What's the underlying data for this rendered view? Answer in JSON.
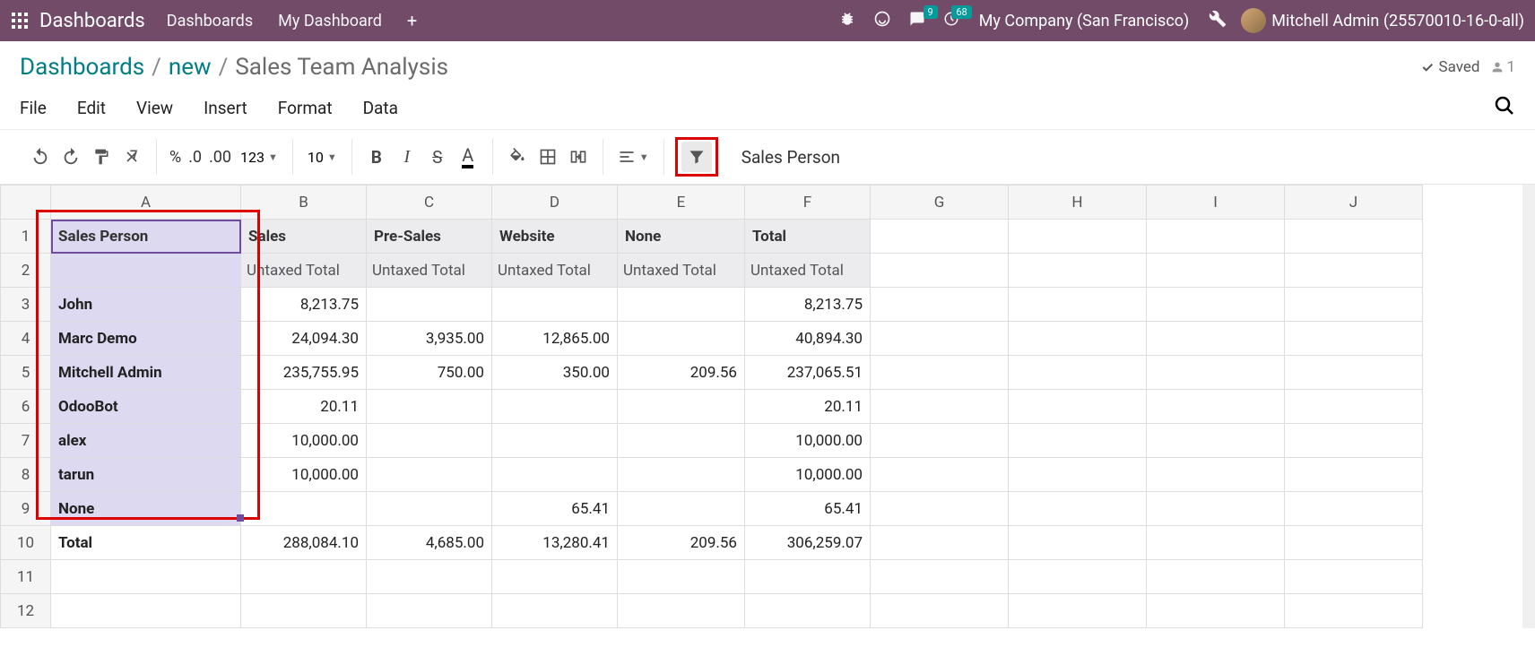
{
  "topnav": {
    "brand": "Dashboards",
    "links": [
      "Dashboards",
      "My Dashboard"
    ],
    "badge_chat": "9",
    "badge_clock": "68",
    "company": "My Company (San Francisco)",
    "username": "Mitchell Admin (25570010-16-0-all)"
  },
  "breadcrumb": {
    "root": "Dashboards",
    "mid": "new",
    "current": "Sales Team Analysis",
    "saved_label": "Saved",
    "user_count": "1"
  },
  "menubar": [
    "File",
    "Edit",
    "View",
    "Insert",
    "Format",
    "Data"
  ],
  "toolbar": {
    "fmt_pct": "%",
    "fmt_dec": ".0",
    "fmt_dec2": ".00",
    "fmt_123": "123",
    "font_size": "10",
    "cell_name": "Sales Person"
  },
  "sheet": {
    "columns": [
      "A",
      "B",
      "C",
      "D",
      "E",
      "F",
      "G",
      "H",
      "I",
      "J"
    ],
    "row_count": 12,
    "headers": [
      "Sales Person",
      "Sales",
      "Pre-Sales",
      "Website",
      "None",
      "Total"
    ],
    "subheader": "Untaxed Total",
    "rows": [
      {
        "label": "John",
        "b": "8,213.75",
        "c": "",
        "d": "",
        "e": "",
        "f": "8,213.75"
      },
      {
        "label": "Marc Demo",
        "b": "24,094.30",
        "c": "3,935.00",
        "d": "12,865.00",
        "e": "",
        "f": "40,894.30"
      },
      {
        "label": "Mitchell Admin",
        "b": "235,755.95",
        "c": "750.00",
        "d": "350.00",
        "e": "209.56",
        "f": "237,065.51"
      },
      {
        "label": "OdooBot",
        "b": "20.11",
        "c": "",
        "d": "",
        "e": "",
        "f": "20.11"
      },
      {
        "label": "alex",
        "b": "10,000.00",
        "c": "",
        "d": "",
        "e": "",
        "f": "10,000.00"
      },
      {
        "label": "tarun",
        "b": "10,000.00",
        "c": "",
        "d": "",
        "e": "",
        "f": "10,000.00"
      },
      {
        "label": "None",
        "b": "",
        "c": "",
        "d": "65.41",
        "e": "",
        "f": "65.41"
      }
    ],
    "total": {
      "label": "Total",
      "b": "288,084.10",
      "c": "4,685.00",
      "d": "13,280.41",
      "e": "209.56",
      "f": "306,259.07"
    }
  }
}
